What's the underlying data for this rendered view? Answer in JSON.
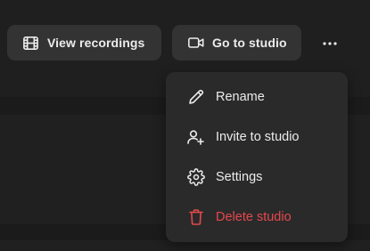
{
  "toolbar": {
    "view_recordings_label": "View recordings",
    "view_recordings_icon": "film-icon",
    "go_to_studio_label": "Go to studio",
    "go_to_studio_icon": "video-camera-icon",
    "more_icon": "more-horizontal-icon"
  },
  "menu": {
    "items": [
      {
        "label": "Rename",
        "icon": "pencil-icon"
      },
      {
        "label": "Invite to studio",
        "icon": "user-plus-icon"
      },
      {
        "label": "Settings",
        "icon": "gear-icon"
      },
      {
        "label": "Delete studio",
        "icon": "trash-icon",
        "color": "#e5484d"
      }
    ]
  },
  "colors": {
    "background": "#1f1f1f",
    "button_bg": "#333333",
    "menu_bg": "#2a2a2a",
    "text": "#ececec",
    "danger": "#e5484d"
  }
}
